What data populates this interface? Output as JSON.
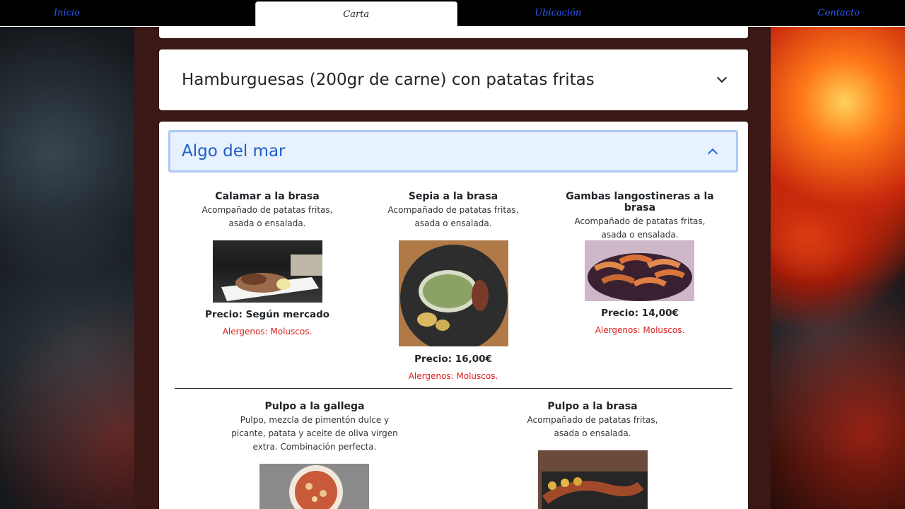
{
  "nav": {
    "items": [
      "Inicio",
      "Carta",
      "Ubicación",
      "Contacto"
    ],
    "active": "Carta"
  },
  "accordion": {
    "closed_title": "Hamburguesas (200gr de carne) con patatas fritas",
    "open_title": "Algo del mar"
  },
  "items": [
    {
      "name": "Calamar a la brasa",
      "desc": "Acompañado de patatas fritas, asada o ensalada.",
      "price": "Precio: Según mercado",
      "alergenos": "Alergenos: Moluscos."
    },
    {
      "name": "Sepia a la brasa",
      "desc": "Acompañado de patatas fritas, asada o ensalada.",
      "price": "Precio: 16,00€",
      "alergenos": "Alergenos: Moluscos."
    },
    {
      "name": "Gambas langostineras a la brasa",
      "desc": "Acompañado de patatas fritas, asada o ensalada.",
      "price": "Precio: 14,00€",
      "alergenos": "Alergenos: Moluscos."
    },
    {
      "name": "Pulpo a la gallega",
      "desc": "Pulpo, mezcla de pimentón dulce y picante, patata y aceite de oliva virgen extra. Combinación perfecta."
    },
    {
      "name": "Pulpo a la brasa",
      "desc": "Acompañado de patatas fritas, asada o ensalada."
    }
  ],
  "colors": {
    "accent": "#1d5fc4",
    "alergenos": "#e02020",
    "nav_link": "#2f5cff"
  }
}
